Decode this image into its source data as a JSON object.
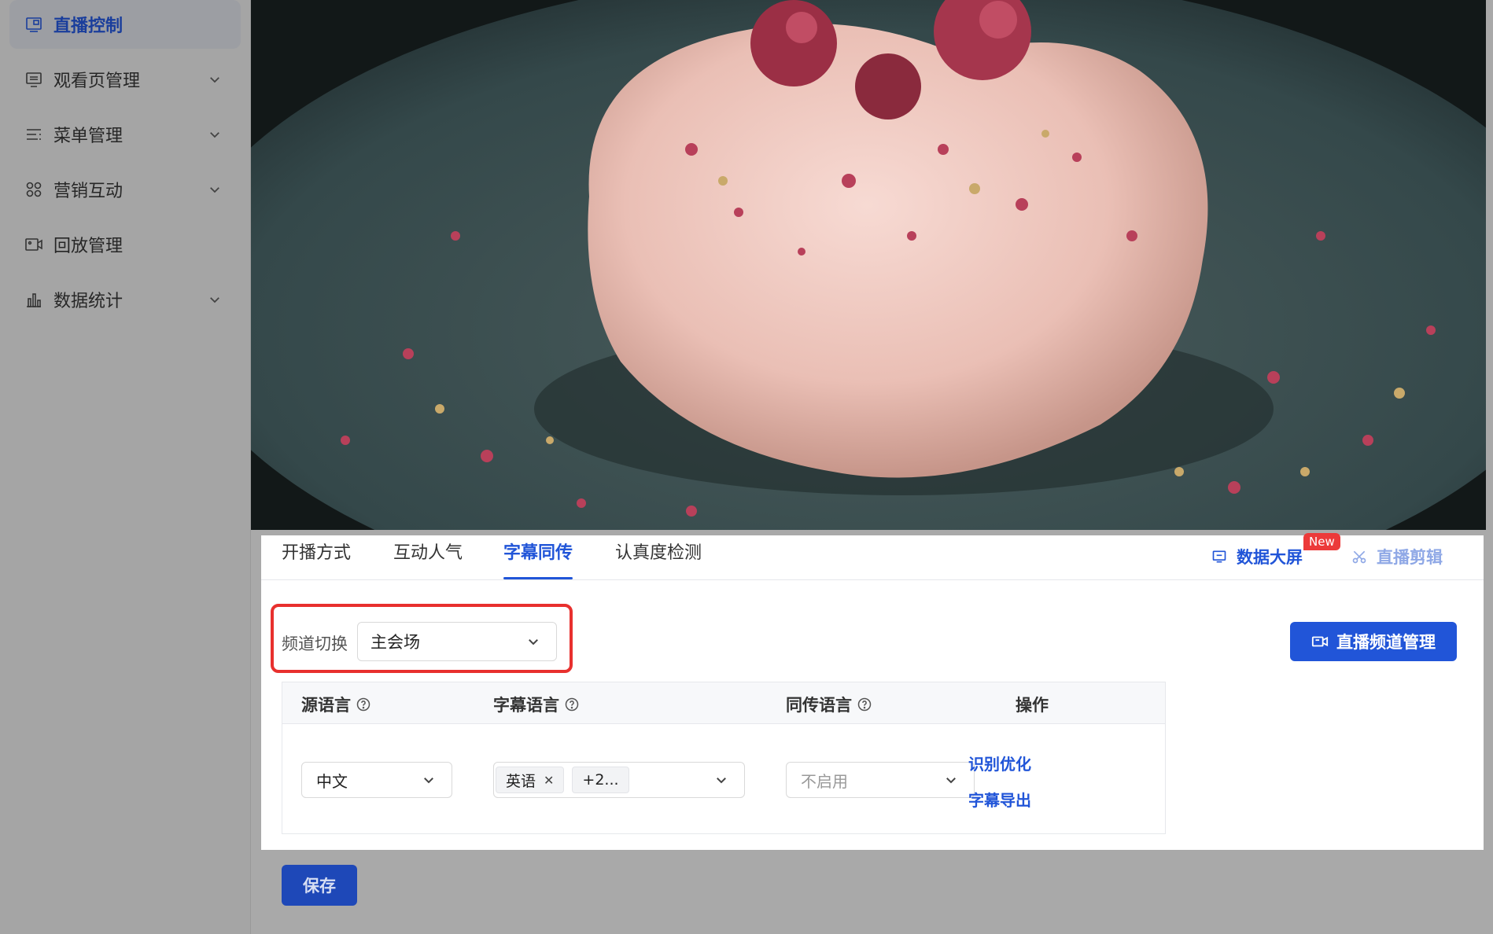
{
  "sidebar": {
    "items": [
      {
        "label": "直播控制",
        "icon": "live-control-icon",
        "active": true,
        "has_submenu": false
      },
      {
        "label": "观看页管理",
        "icon": "watch-page-icon",
        "active": false,
        "has_submenu": true
      },
      {
        "label": "菜单管理",
        "icon": "menu-list-icon",
        "active": false,
        "has_submenu": true
      },
      {
        "label": "营销互动",
        "icon": "marketing-grid-icon",
        "active": false,
        "has_submenu": true
      },
      {
        "label": "回放管理",
        "icon": "playback-video-icon",
        "active": false,
        "has_submenu": false
      },
      {
        "label": "数据统计",
        "icon": "bar-chart-icon",
        "active": false,
        "has_submenu": true
      }
    ]
  },
  "tabs": [
    {
      "label": "开播方式",
      "active": false
    },
    {
      "label": "互动人气",
      "active": false
    },
    {
      "label": "字幕同传",
      "active": true
    },
    {
      "label": "认真度检测",
      "active": false
    }
  ],
  "header_links": {
    "data_screen": "数据大屏",
    "new_badge": "New",
    "live_clip": "直播剪辑"
  },
  "channel": {
    "label": "频道切换",
    "selected": "主会场"
  },
  "manage_button": "直播频道管理",
  "table": {
    "headers": [
      "源语言",
      "字幕语言",
      "同传语言",
      "操作"
    ],
    "row": {
      "source_language": "中文",
      "subtitle_tags": [
        "英语",
        "+2..."
      ],
      "interpretation_language": "不启用",
      "actions": [
        "识别优化",
        "字幕导出"
      ]
    }
  },
  "save_button": "保存",
  "colors": {
    "accent": "#2155d8",
    "highlight_border": "#e8302e",
    "badge": "#ec3a3a"
  }
}
